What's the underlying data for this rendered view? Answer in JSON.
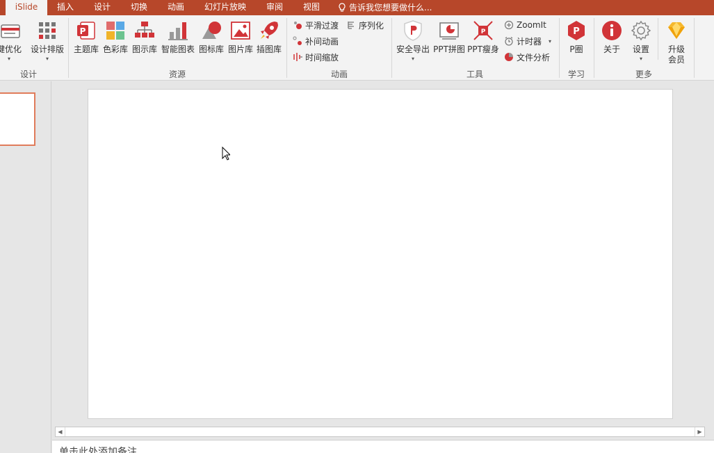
{
  "tabs": [
    {
      "label": "iSlide",
      "active": true
    },
    {
      "label": "插入"
    },
    {
      "label": "设计"
    },
    {
      "label": "切换"
    },
    {
      "label": "动画"
    },
    {
      "label": "幻灯片放映"
    },
    {
      "label": "审阅"
    },
    {
      "label": "视图"
    }
  ],
  "tell_me": {
    "text": "告诉我您想要做什么..."
  },
  "ribbon": {
    "groups": {
      "design": "设计",
      "resources": "资源",
      "animation": "动画",
      "tools": "工具",
      "learn": "学习",
      "more": "更多"
    },
    "buttons": {
      "one_click_optimize": "键优化",
      "design_layout": "设计排版",
      "theme_lib": "主题库",
      "color_lib": "色彩库",
      "diagram_lib": "图示库",
      "smart_chart": "智能图表",
      "icon_lib": "图标库",
      "picture_lib": "图片库",
      "illustration_lib": "插图库",
      "smooth_transition": "平滑过渡",
      "serialize": "序列化",
      "tween_animation": "补间动画",
      "time_scale": "时间缩放",
      "safe_export": "安全导出",
      "ppt_collage": "PPT拼图",
      "ppt_slim": "PPT瘦身",
      "zoomit": "ZoomIt",
      "timer": "计时器",
      "file_analysis": "文件分析",
      "p_circle": "P圈",
      "about": "关于",
      "settings": "设置",
      "upgrade_line1": "升级",
      "upgrade_line2": "会员"
    }
  },
  "notes": {
    "placeholder": "单击此处添加备注"
  },
  "colors": {
    "accent": "#b7472a",
    "ribbon_bg": "#f3f3f3",
    "icon_red": "#d13438"
  }
}
